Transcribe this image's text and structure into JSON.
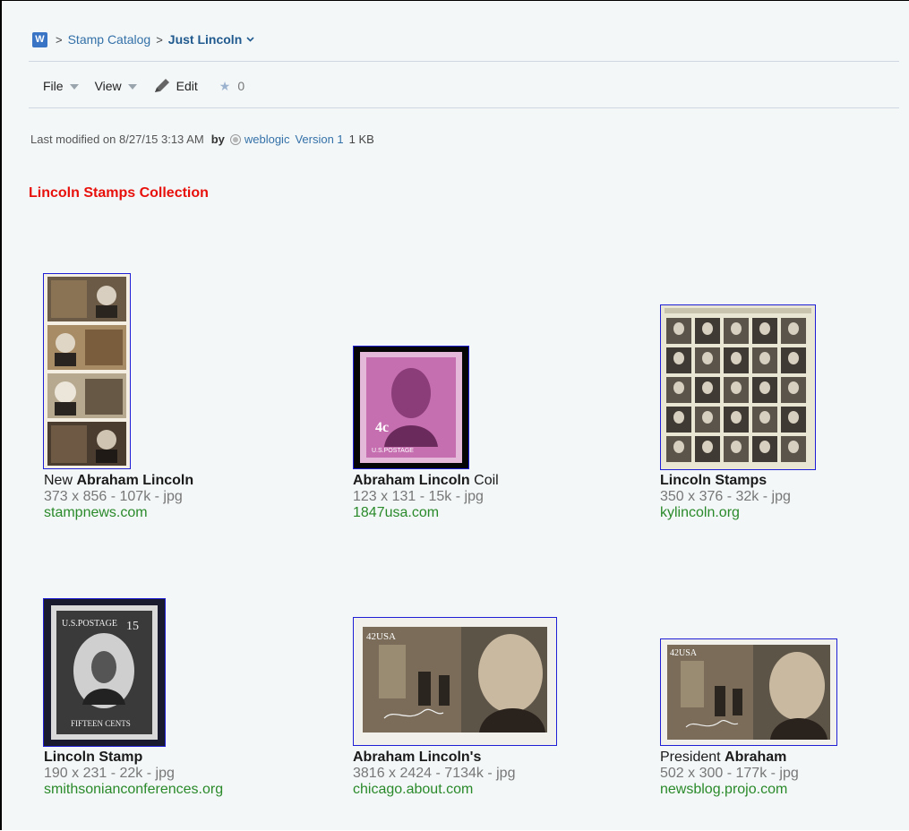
{
  "breadcrumb": {
    "app_icon": "W",
    "separator": ">",
    "parent": "Stamp Catalog",
    "current": "Just Lincoln",
    "chevron": "⌄"
  },
  "toolbar": {
    "file_label": "File",
    "view_label": "View",
    "edit_label": "Edit",
    "favorite_count": "0"
  },
  "meta": {
    "modified": "Last modified on 8/27/15 3:13 AM",
    "by_label": "by",
    "user": "weblogic",
    "version": "Version 1",
    "size": "1 KB"
  },
  "document_title": "Lincoln Stamps Collection",
  "results": [
    {
      "pre": "New ",
      "bold": "Abraham Lincoln",
      "post": "",
      "dims": "373 x 856 - 107k - jpg",
      "site": "stampnews.com"
    },
    {
      "pre": "",
      "bold": "Abraham Lincoln",
      "post": " Coil",
      "dims": "123 x 131 - 15k - jpg",
      "site": "1847usa.com"
    },
    {
      "pre": "",
      "bold": "Lincoln Stamps",
      "post": "",
      "dims": "350 x 376 - 32k - jpg",
      "site": "kylincoln.org"
    },
    {
      "pre": "",
      "bold": "Lincoln Stamp",
      "post": "",
      "dims": "190 x 231 - 22k - jpg",
      "site": "smithsonianconferences.org"
    },
    {
      "pre": "",
      "bold": "Abraham Lincoln's",
      "post": "",
      "dims": "3816 x 2424 - 7134k - jpg",
      "site": "chicago.about.com"
    },
    {
      "pre": "President ",
      "bold": "Abraham",
      "post": "",
      "dims": "502 x 300 - 177k - jpg",
      "site": "newsblog.projo.com"
    }
  ],
  "stamp_text": {
    "coil_value": "4c",
    "coil_postage": "U.S.POSTAGE",
    "engraved_top": "U.S.POSTAGE",
    "engraved_value": "15",
    "engraved_bottom": "FIFTEEN CENTS",
    "forever_1": "42USA",
    "forever_2": "42USA"
  },
  "colors": {
    "title_red": "#e8100b",
    "link_blue": "#3471a8",
    "site_green": "#2a8a2a",
    "thumb_border": "#1f1fd6",
    "background": "#f3f7f8"
  }
}
